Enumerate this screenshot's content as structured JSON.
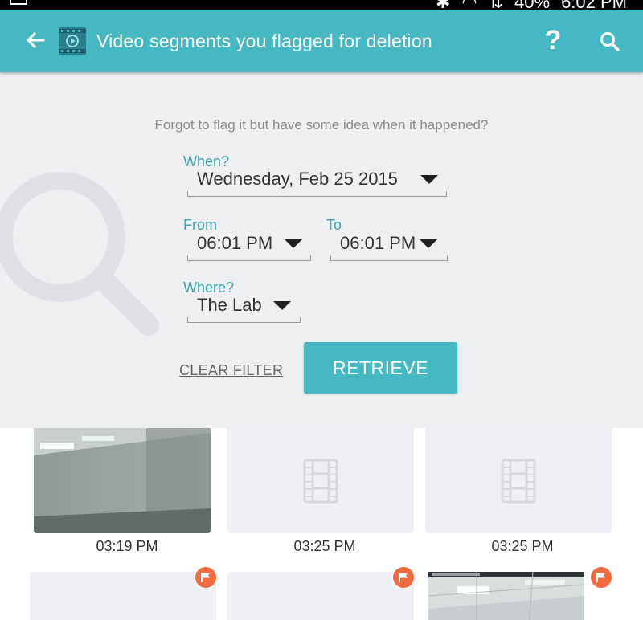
{
  "status_bar": {
    "battery_text": "40%",
    "clock_text": "6:02 PM"
  },
  "header": {
    "title": "Video segments you flagged for deletion",
    "help_label": "?",
    "icons": [
      "back-arrow-icon",
      "video-logo-icon",
      "help-icon",
      "search-icon"
    ],
    "background_color": "#46b8c4"
  },
  "filter": {
    "hint": "Forgot to flag it but have some idea when it happened?",
    "when": {
      "label": "When?",
      "value": "Wednesday, Feb 25 2015"
    },
    "from": {
      "label": "From",
      "value": "06:01 PM"
    },
    "to": {
      "label": "To",
      "value": "06:01 PM"
    },
    "where": {
      "label": "Where?",
      "value": "The Lab"
    },
    "clear_label": "CLEAR FILTER",
    "retrieve_label": "RETRIEVE",
    "accent_color": "#3fa3ad"
  },
  "segments": [
    {
      "time": "03:19 PM",
      "thumbnail": "room-photo",
      "flagged": false
    },
    {
      "time": "03:25 PM",
      "thumbnail": "film-placeholder-icon",
      "flagged": false
    },
    {
      "time": "03:25 PM",
      "thumbnail": "film-placeholder-icon",
      "flagged": false
    },
    {
      "time": "",
      "thumbnail": "placeholder",
      "flagged": true
    },
    {
      "time": "",
      "thumbnail": "placeholder",
      "flagged": true
    },
    {
      "time": "",
      "thumbnail": "room-photo",
      "flagged": true
    }
  ],
  "flag_color": "#f26b3f"
}
